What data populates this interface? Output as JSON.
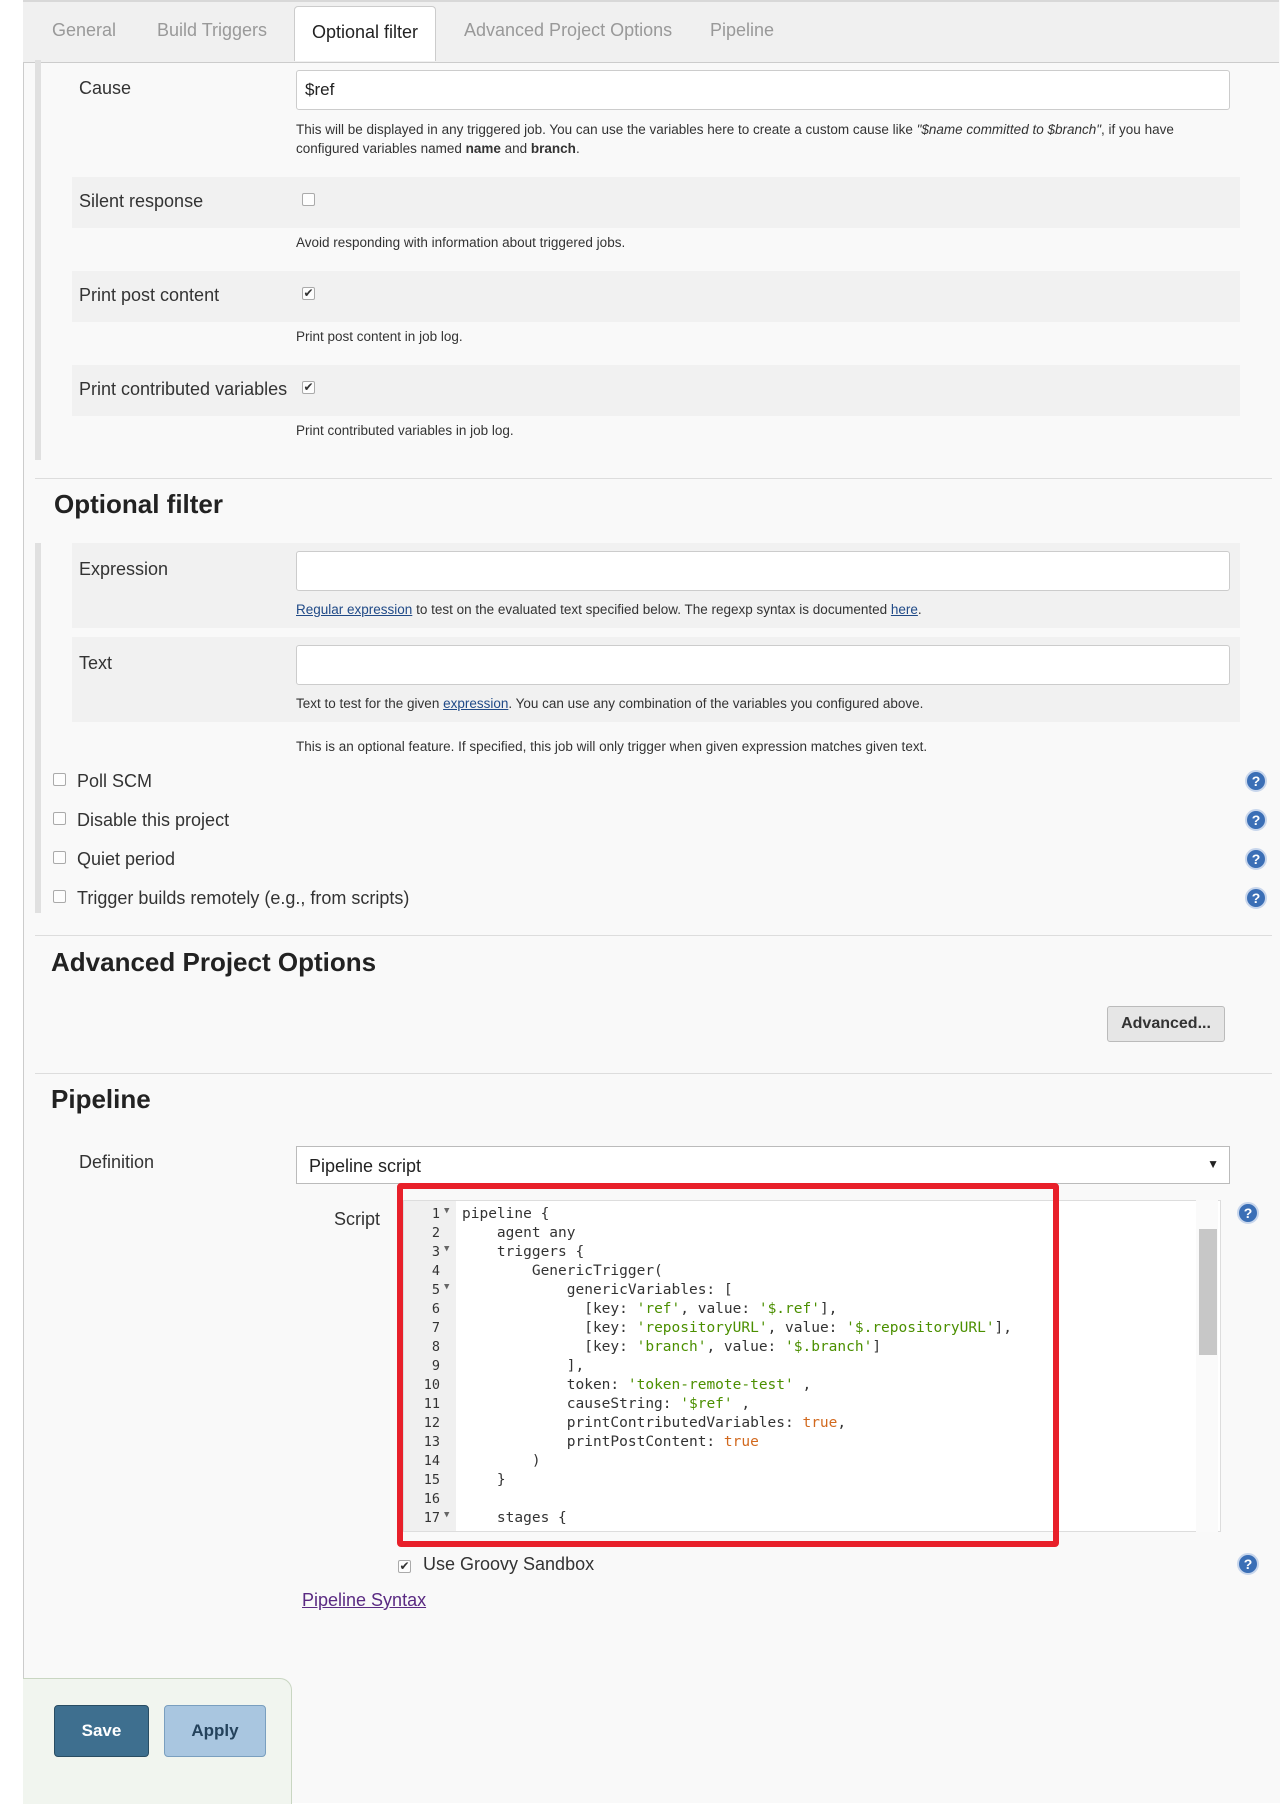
{
  "tabs": [
    "General",
    "Build Triggers",
    "Optional filter",
    "Advanced Project Options",
    "Pipeline"
  ],
  "cause": {
    "label": "Cause",
    "value": "$ref",
    "help_prefix": "This will be displayed in any triggered job. You can use the variables here to create a custom cause like ",
    "help_example": "\"$name committed to $branch\"",
    "help_mid": ", if you have",
    "help_line2_prefix": "configured variables named ",
    "help_var1": "name",
    "help_and": " and ",
    "help_var2": "branch",
    "help_end": "."
  },
  "silent_response": {
    "label": "Silent response",
    "checked": false,
    "help": "Avoid responding with information about triggered jobs."
  },
  "print_post_content": {
    "label": "Print post content",
    "checked": true,
    "help": "Print post content in job log."
  },
  "print_contributed_variables": {
    "label": "Print contributed variables",
    "checked": true,
    "help": "Print contributed variables in job log."
  },
  "optional_filter": {
    "title": "Optional filter",
    "expression_label": "Expression",
    "expression_value": "",
    "expression_help_link": "Regular expression",
    "expression_help_text": " to test on the evaluated text specified below. The regexp syntax is documented ",
    "expression_help_link2": "here",
    "expression_help_end": ".",
    "text_label": "Text",
    "text_value": "",
    "text_help_prefix": "Text to test for the given ",
    "text_help_link": "expression",
    "text_help_suffix": ". You can use any combination of the variables you configured above.",
    "feature_note": "This is an optional feature. If specified, this job will only trigger when given expression matches given text."
  },
  "options": [
    {
      "label": "Poll SCM",
      "checked": false
    },
    {
      "label": "Disable this project",
      "checked": false
    },
    {
      "label": "Quiet period",
      "checked": false
    },
    {
      "label": "Trigger builds remotely (e.g., from scripts)",
      "checked": false
    }
  ],
  "advanced_project_options": {
    "title": "Advanced Project Options",
    "button": "Advanced..."
  },
  "pipeline": {
    "title": "Pipeline",
    "definition_label": "Definition",
    "definition_value": "Pipeline script",
    "script_label": "Script",
    "sandbox_label": "Use Groovy Sandbox",
    "sandbox_checked": true,
    "syntax_link": "Pipeline Syntax",
    "script_lines": [
      "1",
      "2",
      "3",
      "4",
      "5",
      "6",
      "7",
      "8",
      "9",
      "10",
      "11",
      "12",
      "13",
      "14",
      "15",
      "16",
      "17"
    ]
  },
  "help_glyph": "?",
  "check_glyph": "✔",
  "dropdown_glyph": "▼",
  "buttons": {
    "save": "Save",
    "apply": "Apply"
  },
  "colors": {
    "accent_red": "#e8202a",
    "save": "#3e6f8f",
    "apply": "#a9c6e0",
    "help": "#3b6fb6"
  }
}
